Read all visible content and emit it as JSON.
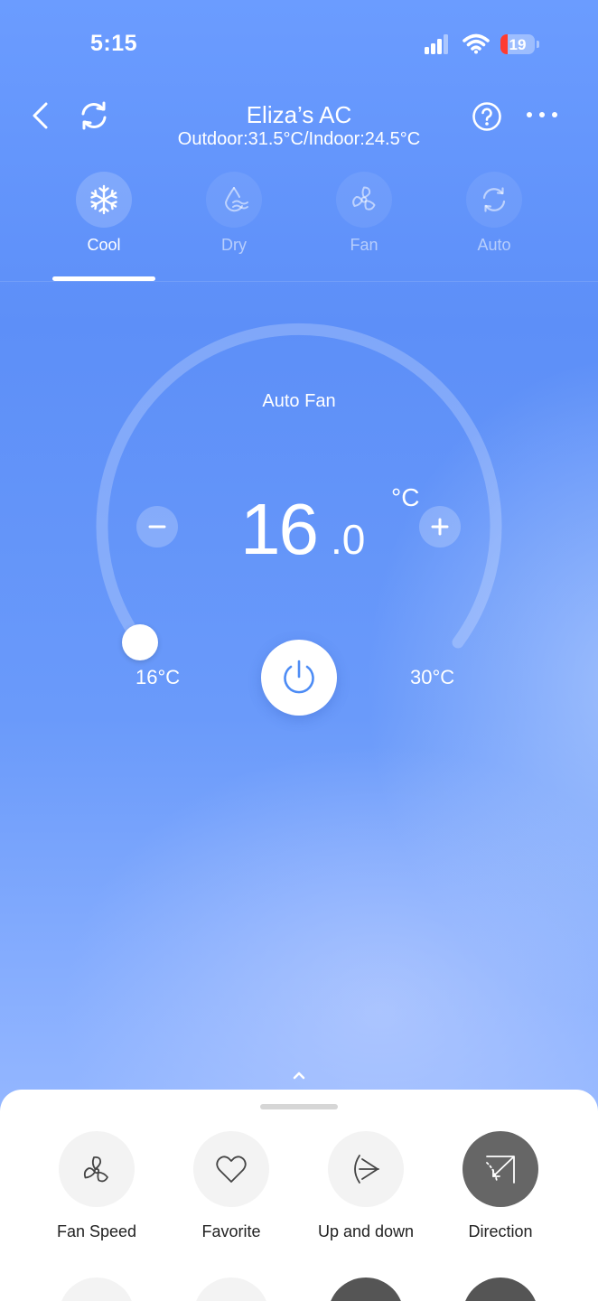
{
  "status_bar": {
    "time": "5:15",
    "battery_level": "19",
    "icons": [
      "signal-icon",
      "wifi-icon",
      "battery-icon"
    ]
  },
  "header": {
    "title": "Eliza’s AC",
    "subtitle": "Outdoor:31.5°C/Indoor:24.5°C",
    "icons": [
      "back-icon",
      "refresh-icon",
      "help-icon",
      "more-icon"
    ]
  },
  "modes": [
    {
      "label": "Cool",
      "icon": "snowflake-icon",
      "active": true
    },
    {
      "label": "Dry",
      "icon": "drop-icon",
      "active": false
    },
    {
      "label": "Fan",
      "icon": "fan-icon",
      "active": false
    },
    {
      "label": "Auto",
      "icon": "auto-icon",
      "active": false
    }
  ],
  "thermostat": {
    "fan_mode": "Auto Fan",
    "temp_int": "16",
    "temp_dec": ".0",
    "unit": "°C",
    "min_label": "16°C",
    "max_label": "30°C",
    "current_value": 16,
    "min_value": 16,
    "max_value": 30
  },
  "functions": [
    {
      "label": "Fan Speed",
      "icon": "fan-speed-icon",
      "active": false
    },
    {
      "label": "Favorite",
      "icon": "heart-icon",
      "active": false
    },
    {
      "label": "Up and down",
      "icon": "swing-vertical-icon",
      "active": false
    },
    {
      "label": "Direction",
      "icon": "direction-icon",
      "active": true
    }
  ],
  "colors": {
    "background": "#6b9cff",
    "active_function": "#666666",
    "power_icon": "#4d8cf5",
    "battery_low": "#ff3b30"
  }
}
